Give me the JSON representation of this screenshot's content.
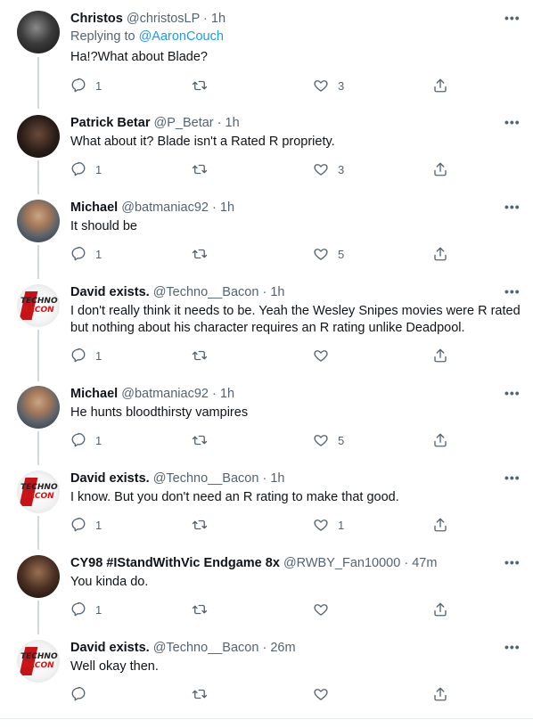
{
  "tweets": [
    {
      "name": "Christos",
      "handle": "@christosLP",
      "time": "1h",
      "reply_prefix": "Replying to ",
      "reply_to": "@AaronCouch",
      "text": "Ha!?What about Blade?",
      "replies": "1",
      "retweets": "",
      "likes": "3",
      "avatar": "avatar-christos"
    },
    {
      "name": "Patrick Betar",
      "handle": "@P_Betar",
      "time": "1h",
      "text": "What about it? Blade isn't a Rated R propriety.",
      "replies": "1",
      "retweets": "",
      "likes": "3",
      "avatar": "avatar-patrick"
    },
    {
      "name": "Michael",
      "handle": "@batmaniac92",
      "time": "1h",
      "text": "It should be",
      "replies": "1",
      "retweets": "",
      "likes": "5",
      "avatar": "avatar-michael"
    },
    {
      "name": "David exists.",
      "handle": "@Techno__Bacon",
      "time": "1h",
      "text": "I don't really think it needs to be. Yeah the Wesley Snipes movies were R rated but nothing about his character requires an R rating unlike Deadpool.",
      "replies": "1",
      "retweets": "",
      "likes": "",
      "avatar": "avatar-techno-bacon"
    },
    {
      "name": "Michael",
      "handle": "@batmaniac92",
      "time": "1h",
      "text": "He hunts bloodthirsty vampires",
      "replies": "1",
      "retweets": "",
      "likes": "5",
      "avatar": "avatar-michael"
    },
    {
      "name": "David exists.",
      "handle": "@Techno__Bacon",
      "time": "1h",
      "text": "I know. But you don't need an R rating to make that good.",
      "replies": "1",
      "retweets": "",
      "likes": "1",
      "avatar": "avatar-techno-bacon"
    },
    {
      "name": "CY98 #IStandWithVic Endgame 8x",
      "handle": "@RWBY_Fan10000",
      "time": "47m",
      "text": "You kinda do.",
      "replies": "1",
      "retweets": "",
      "likes": "",
      "avatar": "avatar-cy98"
    },
    {
      "name": "David exists.",
      "handle": "@Techno__Bacon",
      "time": "26m",
      "text": "Well okay then.",
      "replies": "",
      "retweets": "",
      "likes": "",
      "avatar": "avatar-techno-bacon"
    }
  ],
  "more_label": "•••",
  "dot": "·",
  "logo": {
    "line1": "TECHNO",
    "line2": "BACON"
  },
  "colors": {
    "accent": "#1d9bf0",
    "text": "#0f1419",
    "muted": "#536471",
    "thread_line": "#cfd9de"
  }
}
